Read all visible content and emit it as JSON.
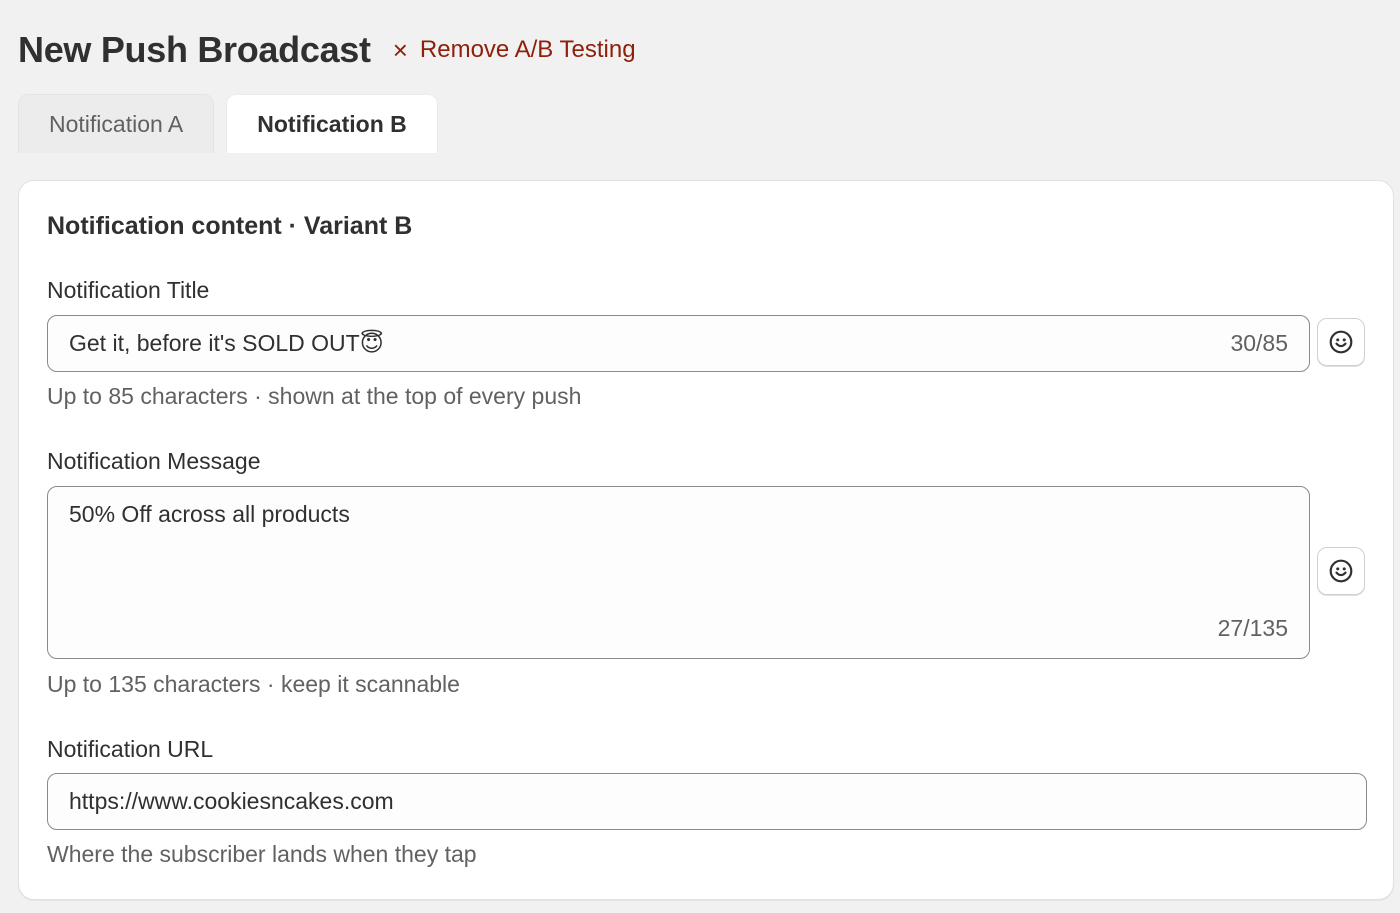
{
  "header": {
    "title": "New Push Broadcast",
    "remove_ab_label": "Remove A/B Testing",
    "remove_ab_icon": "×"
  },
  "tabs": [
    {
      "label": "Notification A",
      "active": false
    },
    {
      "label": "Notification B",
      "active": true
    }
  ],
  "card": {
    "title": "Notification content · Variant B",
    "title_field": {
      "label": "Notification Title",
      "value": "Get it, before it's SOLD OUT😇",
      "counter": "30/85",
      "help": "Up to 85 characters · shown at the top of every push"
    },
    "message_field": {
      "label": "Notification Message",
      "value": "50% Off across all products",
      "counter": "27/135",
      "help": "Up to 135 characters · keep it scannable"
    },
    "url_field": {
      "label": "Notification URL",
      "value": "https://www.cookiesncakes.com",
      "help": "Where the subscriber lands when they tap"
    }
  },
  "colors": {
    "background": "#f1f1f1",
    "card": "#ffffff",
    "text": "#303030",
    "muted": "#616161",
    "danger": "#8e1f0b",
    "field_border": "#8a8a8a"
  },
  "icons": {
    "emoji_picker": "smiley-icon",
    "remove": "close-icon"
  }
}
